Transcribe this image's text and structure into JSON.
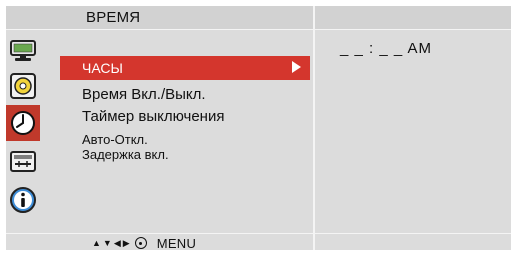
{
  "osd": {
    "title": "ВРЕМЯ",
    "colors": {
      "panel": "#dcdcdc",
      "selected": "#d4362d",
      "active_icon_bg": "#c0392b"
    }
  },
  "sidebar": {
    "icons": [
      {
        "name": "picture-icon",
        "active": false
      },
      {
        "name": "sound-icon",
        "active": false
      },
      {
        "name": "time-icon",
        "active": true
      },
      {
        "name": "option-icon",
        "active": false
      },
      {
        "name": "information-icon",
        "active": false
      }
    ]
  },
  "menu": {
    "items": [
      {
        "label": "ЧАСЫ",
        "selected": true
      },
      {
        "label": "Время Вкл./Выкл.",
        "selected": false
      },
      {
        "label": "Таймер выключения",
        "selected": false
      },
      {
        "label": "Авто-Откл.",
        "selected": false
      },
      {
        "label": "Задержка вкл.",
        "selected": false
      }
    ]
  },
  "detail": {
    "clock_value": "_ _ : _ _  AM"
  },
  "footer": {
    "nav_up": "▲",
    "nav_down": "▼",
    "nav_left": "◀",
    "nav_right": "▶",
    "menu_label": "MENU"
  }
}
